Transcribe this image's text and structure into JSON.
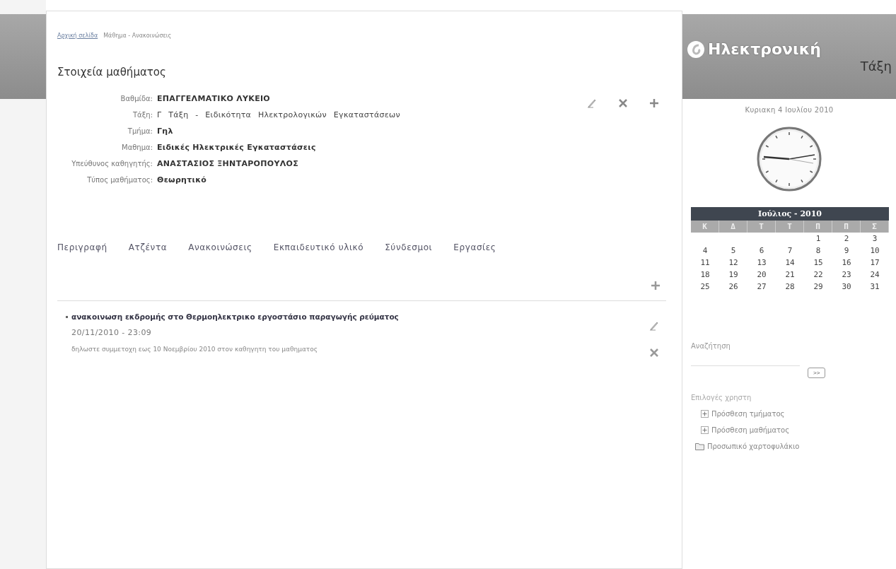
{
  "breadcrumb": {
    "home_link": "Αρχική σελίδα",
    "current": "Μάθημα - Ανακοινώσεις"
  },
  "section_title": "Στοιχεία μαθήματος",
  "course_fields": [
    {
      "label": "Βαθμίδα:",
      "value": "ΕΠΑΓΓΕΛΜΑΤΙΚΟ ΛΥΚΕΙΟ",
      "emphasis": true
    },
    {
      "label": "Τάξη:",
      "value": "Γ Τάξη - Ειδικότητα Ηλεκτρολογικών Εγκαταστάσεων",
      "emphasis": false
    },
    {
      "label": "Τμήμα:",
      "value": "Γηλ",
      "emphasis": true
    },
    {
      "label": "Μαθημα:",
      "value": "Ειδικές Ηλεκτρικές Εγκαταστάσεις",
      "emphasis": true
    },
    {
      "label": "Υπεύθυνος καθηγητής:",
      "value": "ΑΝΑΣΤΑΣΙΟΣ ΞΗΝΤΑΡΟΠΟΥΛΟΣ",
      "emphasis": true
    },
    {
      "label": "Τύπος μαθήματος:",
      "value": "Θεωρητικό",
      "emphasis": true
    }
  ],
  "tabs": [
    "Περιγραφή",
    "Ατζέντα",
    "Ανακοινώσεις",
    "Εκπαιδευτικό υλικό",
    "Σύνδεσμοι",
    "Εργασίες"
  ],
  "announcements": [
    {
      "title": "ανακοινωση εκδρομής στο Θερμοηλεκτρικο εργοστάσιο παραγωγής ρεύματος",
      "date": "20/11/2010 - 23:09",
      "body": "δηλωστε συμμετοχη εως 10 Νοεμβρίου 2010 στον καθηγητη του μαθηματος"
    }
  ],
  "logo": {
    "line_1": "Ηλεκτρονική",
    "line_2": "Τάξη"
  },
  "date_text": "Κυριακη 4 Ιουλίου 2010",
  "calendar": {
    "title": "Ιούλιος - 2010",
    "weekdays": [
      "Κ",
      "Δ",
      "Τ",
      "Τ",
      "Π",
      "Π",
      "Σ"
    ],
    "weeks": [
      {
        "kind": "partial",
        "days": [
          "1",
          "2",
          "3"
        ]
      },
      {
        "kind": "full",
        "days": [
          "4",
          "5",
          "6",
          "7",
          "8",
          "9",
          "10"
        ]
      },
      {
        "kind": "full",
        "days": [
          "11",
          "12",
          "13",
          "14",
          "15",
          "16",
          "17"
        ]
      },
      {
        "kind": "full",
        "days": [
          "18",
          "19",
          "20",
          "21",
          "22",
          "23",
          "24"
        ]
      },
      {
        "kind": "full",
        "days": [
          "25",
          "26",
          "27",
          "28",
          "29",
          "30",
          "31"
        ]
      }
    ]
  },
  "search": {
    "label": "Αναζήτηση",
    "button": ">>"
  },
  "user_options": {
    "title": "Επιλογές χρηστη",
    "items": [
      {
        "label": "Πρόσθεση τμήματος",
        "kind": "add"
      },
      {
        "label": "Πρόσθεση μαθήματος",
        "kind": "add"
      },
      {
        "label": "Προσωπικό χαρτοφυλάκιο",
        "kind": "folder"
      }
    ]
  }
}
